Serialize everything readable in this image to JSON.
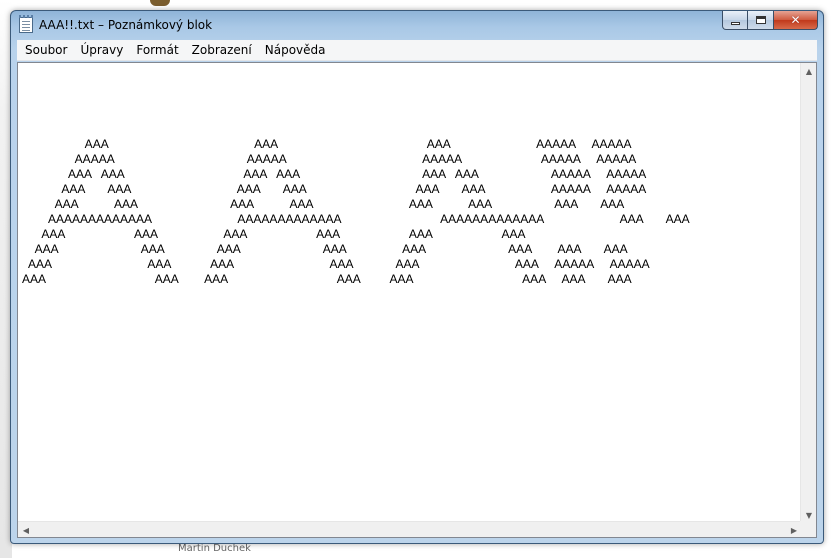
{
  "window": {
    "title": "AAA!!.txt – Poznámkový blok"
  },
  "buttons": {
    "minimize": "",
    "maximize": "",
    "close": "✕"
  },
  "menu": [
    "Soubor",
    "Úpravy",
    "Formát",
    "Zobrazení",
    "Nápověda"
  ],
  "document": {
    "lines": [
      "                   AAA                                            AAA                                             AAA                          AAAAA     AAAAA",
      "                AAAAA                                        AAAAA                                         AAAAA                        AAAAA     AAAAA",
      "              AAA   AAA                                    AAA   AAA                                     AAA   AAA                      AAAAA     AAAAA",
      "            AAA       AAA                                AAA       AAA                                 AAA       AAA                    AAAAA     AAAAA",
      "          AAA           AAA                            AAA           AAA                             AAA           AAA                   AAA       AAA",
      "        AAAAAAAAAAAAA                          AAAAAAAAAAAAA                              AAAAAAAAAAAAA                       AAA       AAA",
      "      AAA                     AAA                    AAA                     AAA                     AAA                     AAA",
      "    AAA                         AAA                AAA                         AAA                 AAA                         AAA        AAA       AAA",
      "  AAA                             AAA            AAA                             AAA             AAA                             AAA     AAAAA     AAAAA",
      "AAA                                 AAA        AAA                                 AAA         AAA                                 AAA     AAA       AAA"
    ]
  },
  "desktop": {
    "bottom_text": "Martin Duchek"
  },
  "scroll": {
    "up": "▲",
    "down": "▼",
    "left": "◀",
    "right": "▶"
  }
}
